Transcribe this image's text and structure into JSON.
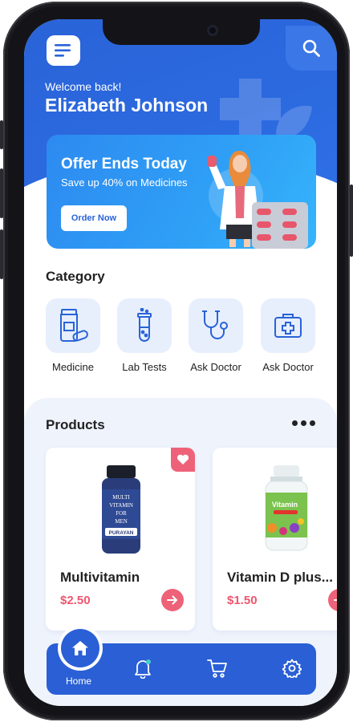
{
  "header": {
    "welcome": "Welcome back!",
    "user_name": "Elizabeth Johnson"
  },
  "banner": {
    "title": "Offer Ends Today",
    "subtitle": "Save up 40% on Medicines",
    "button_label": "Order Now"
  },
  "category": {
    "title": "Category",
    "items": [
      {
        "label": "Medicine",
        "icon": "medicine-bottle-icon"
      },
      {
        "label": "Lab Tests",
        "icon": "test-tube-icon"
      },
      {
        "label": "Ask Doctor",
        "icon": "stethoscope-icon"
      },
      {
        "label": "Ask Doctor",
        "icon": "medical-kit-icon"
      }
    ]
  },
  "products": {
    "title": "Products",
    "items": [
      {
        "name": "Multivitamin",
        "price": "$2.50",
        "favorited": true,
        "bottle_label": "MULTI VITAMIN FOR MEN",
        "brand": "PURAYAN"
      },
      {
        "name": "Vitamin D plus...",
        "price": "$1.50",
        "favorited": false,
        "bottle_label": "Vitamin"
      }
    ]
  },
  "tabbar": {
    "home_label": "Home",
    "icons": [
      "home-icon",
      "bell-icon",
      "cart-icon",
      "gear-icon"
    ]
  },
  "colors": {
    "primary": "#2a63d8",
    "accent": "#ee6279",
    "banner": "#2fa0f6",
    "category_bg": "#e7effd"
  }
}
